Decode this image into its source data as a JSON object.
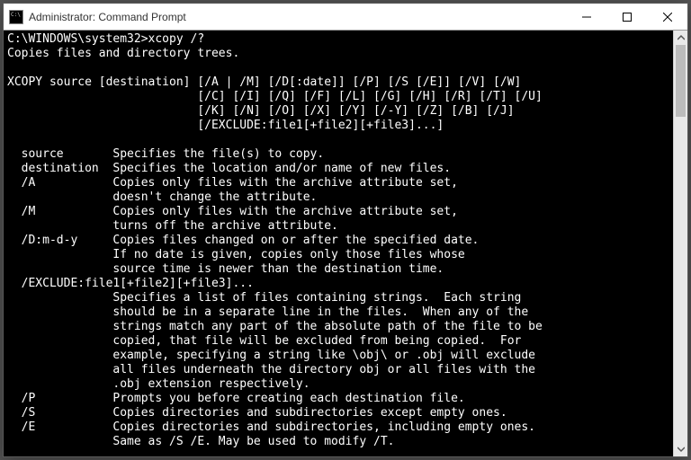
{
  "window": {
    "title": "Administrator: Command Prompt"
  },
  "terminal": {
    "prompt_command": "C:\\WINDOWS\\system32>xcopy /?",
    "desc": "Copies files and directory trees.",
    "syntax_lines": [
      "XCOPY source [destination] [/A | /M] [/D[:date]] [/P] [/S [/E]] [/V] [/W]",
      "                           [/C] [/I] [/Q] [/F] [/L] [/G] [/H] [/R] [/T] [/U]",
      "                           [/K] [/N] [/O] [/X] [/Y] [/-Y] [/Z] [/B] [/J]",
      "                           [/EXCLUDE:file1[+file2][+file3]...]"
    ],
    "options": [
      {
        "key": "  source       ",
        "lines": [
          "Specifies the file(s) to copy."
        ]
      },
      {
        "key": "  destination  ",
        "lines": [
          "Specifies the location and/or name of new files."
        ]
      },
      {
        "key": "  /A           ",
        "lines": [
          "Copies only files with the archive attribute set,",
          "doesn't change the attribute."
        ]
      },
      {
        "key": "  /M           ",
        "lines": [
          "Copies only files with the archive attribute set,",
          "turns off the archive attribute."
        ]
      },
      {
        "key": "  /D:m-d-y     ",
        "lines": [
          "Copies files changed on or after the specified date.",
          "If no date is given, copies only those files whose",
          "source time is newer than the destination time."
        ]
      },
      {
        "key": "  /EXCLUDE:file1[+file2][+file3]...",
        "lines": [
          "",
          "Specifies a list of files containing strings.  Each string",
          "should be in a separate line in the files.  When any of the",
          "strings match any part of the absolute path of the file to be",
          "copied, that file will be excluded from being copied.  For",
          "example, specifying a string like \\obj\\ or .obj will exclude",
          "all files underneath the directory obj or all files with the",
          ".obj extension respectively."
        ]
      },
      {
        "key": "  /P           ",
        "lines": [
          "Prompts you before creating each destination file."
        ]
      },
      {
        "key": "  /S           ",
        "lines": [
          "Copies directories and subdirectories except empty ones."
        ]
      },
      {
        "key": "  /E           ",
        "lines": [
          "Copies directories and subdirectories, including empty ones.",
          "Same as /S /E. May be used to modify /T."
        ]
      }
    ],
    "indent": "               "
  }
}
